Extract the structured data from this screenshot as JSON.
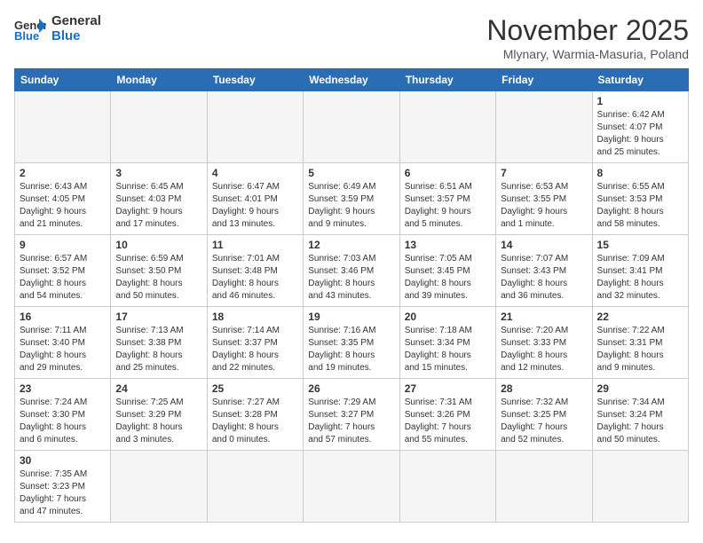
{
  "header": {
    "logo_general": "General",
    "logo_blue": "Blue",
    "month_title": "November 2025",
    "location": "Mlynary, Warmia-Masuria, Poland"
  },
  "weekdays": [
    "Sunday",
    "Monday",
    "Tuesday",
    "Wednesday",
    "Thursday",
    "Friday",
    "Saturday"
  ],
  "weeks": [
    [
      {
        "day": "",
        "info": ""
      },
      {
        "day": "",
        "info": ""
      },
      {
        "day": "",
        "info": ""
      },
      {
        "day": "",
        "info": ""
      },
      {
        "day": "",
        "info": ""
      },
      {
        "day": "",
        "info": ""
      },
      {
        "day": "1",
        "info": "Sunrise: 6:42 AM\nSunset: 4:07 PM\nDaylight: 9 hours\nand 25 minutes."
      }
    ],
    [
      {
        "day": "2",
        "info": "Sunrise: 6:43 AM\nSunset: 4:05 PM\nDaylight: 9 hours\nand 21 minutes."
      },
      {
        "day": "3",
        "info": "Sunrise: 6:45 AM\nSunset: 4:03 PM\nDaylight: 9 hours\nand 17 minutes."
      },
      {
        "day": "4",
        "info": "Sunrise: 6:47 AM\nSunset: 4:01 PM\nDaylight: 9 hours\nand 13 minutes."
      },
      {
        "day": "5",
        "info": "Sunrise: 6:49 AM\nSunset: 3:59 PM\nDaylight: 9 hours\nand 9 minutes."
      },
      {
        "day": "6",
        "info": "Sunrise: 6:51 AM\nSunset: 3:57 PM\nDaylight: 9 hours\nand 5 minutes."
      },
      {
        "day": "7",
        "info": "Sunrise: 6:53 AM\nSunset: 3:55 PM\nDaylight: 9 hours\nand 1 minute."
      },
      {
        "day": "8",
        "info": "Sunrise: 6:55 AM\nSunset: 3:53 PM\nDaylight: 8 hours\nand 58 minutes."
      }
    ],
    [
      {
        "day": "9",
        "info": "Sunrise: 6:57 AM\nSunset: 3:52 PM\nDaylight: 8 hours\nand 54 minutes."
      },
      {
        "day": "10",
        "info": "Sunrise: 6:59 AM\nSunset: 3:50 PM\nDaylight: 8 hours\nand 50 minutes."
      },
      {
        "day": "11",
        "info": "Sunrise: 7:01 AM\nSunset: 3:48 PM\nDaylight: 8 hours\nand 46 minutes."
      },
      {
        "day": "12",
        "info": "Sunrise: 7:03 AM\nSunset: 3:46 PM\nDaylight: 8 hours\nand 43 minutes."
      },
      {
        "day": "13",
        "info": "Sunrise: 7:05 AM\nSunset: 3:45 PM\nDaylight: 8 hours\nand 39 minutes."
      },
      {
        "day": "14",
        "info": "Sunrise: 7:07 AM\nSunset: 3:43 PM\nDaylight: 8 hours\nand 36 minutes."
      },
      {
        "day": "15",
        "info": "Sunrise: 7:09 AM\nSunset: 3:41 PM\nDaylight: 8 hours\nand 32 minutes."
      }
    ],
    [
      {
        "day": "16",
        "info": "Sunrise: 7:11 AM\nSunset: 3:40 PM\nDaylight: 8 hours\nand 29 minutes."
      },
      {
        "day": "17",
        "info": "Sunrise: 7:13 AM\nSunset: 3:38 PM\nDaylight: 8 hours\nand 25 minutes."
      },
      {
        "day": "18",
        "info": "Sunrise: 7:14 AM\nSunset: 3:37 PM\nDaylight: 8 hours\nand 22 minutes."
      },
      {
        "day": "19",
        "info": "Sunrise: 7:16 AM\nSunset: 3:35 PM\nDaylight: 8 hours\nand 19 minutes."
      },
      {
        "day": "20",
        "info": "Sunrise: 7:18 AM\nSunset: 3:34 PM\nDaylight: 8 hours\nand 15 minutes."
      },
      {
        "day": "21",
        "info": "Sunrise: 7:20 AM\nSunset: 3:33 PM\nDaylight: 8 hours\nand 12 minutes."
      },
      {
        "day": "22",
        "info": "Sunrise: 7:22 AM\nSunset: 3:31 PM\nDaylight: 8 hours\nand 9 minutes."
      }
    ],
    [
      {
        "day": "23",
        "info": "Sunrise: 7:24 AM\nSunset: 3:30 PM\nDaylight: 8 hours\nand 6 minutes."
      },
      {
        "day": "24",
        "info": "Sunrise: 7:25 AM\nSunset: 3:29 PM\nDaylight: 8 hours\nand 3 minutes."
      },
      {
        "day": "25",
        "info": "Sunrise: 7:27 AM\nSunset: 3:28 PM\nDaylight: 8 hours\nand 0 minutes."
      },
      {
        "day": "26",
        "info": "Sunrise: 7:29 AM\nSunset: 3:27 PM\nDaylight: 7 hours\nand 57 minutes."
      },
      {
        "day": "27",
        "info": "Sunrise: 7:31 AM\nSunset: 3:26 PM\nDaylight: 7 hours\nand 55 minutes."
      },
      {
        "day": "28",
        "info": "Sunrise: 7:32 AM\nSunset: 3:25 PM\nDaylight: 7 hours\nand 52 minutes."
      },
      {
        "day": "29",
        "info": "Sunrise: 7:34 AM\nSunset: 3:24 PM\nDaylight: 7 hours\nand 50 minutes."
      }
    ],
    [
      {
        "day": "30",
        "info": "Sunrise: 7:35 AM\nSunset: 3:23 PM\nDaylight: 7 hours\nand 47 minutes."
      },
      {
        "day": "",
        "info": ""
      },
      {
        "day": "",
        "info": ""
      },
      {
        "day": "",
        "info": ""
      },
      {
        "day": "",
        "info": ""
      },
      {
        "day": "",
        "info": ""
      },
      {
        "day": "",
        "info": ""
      }
    ]
  ]
}
